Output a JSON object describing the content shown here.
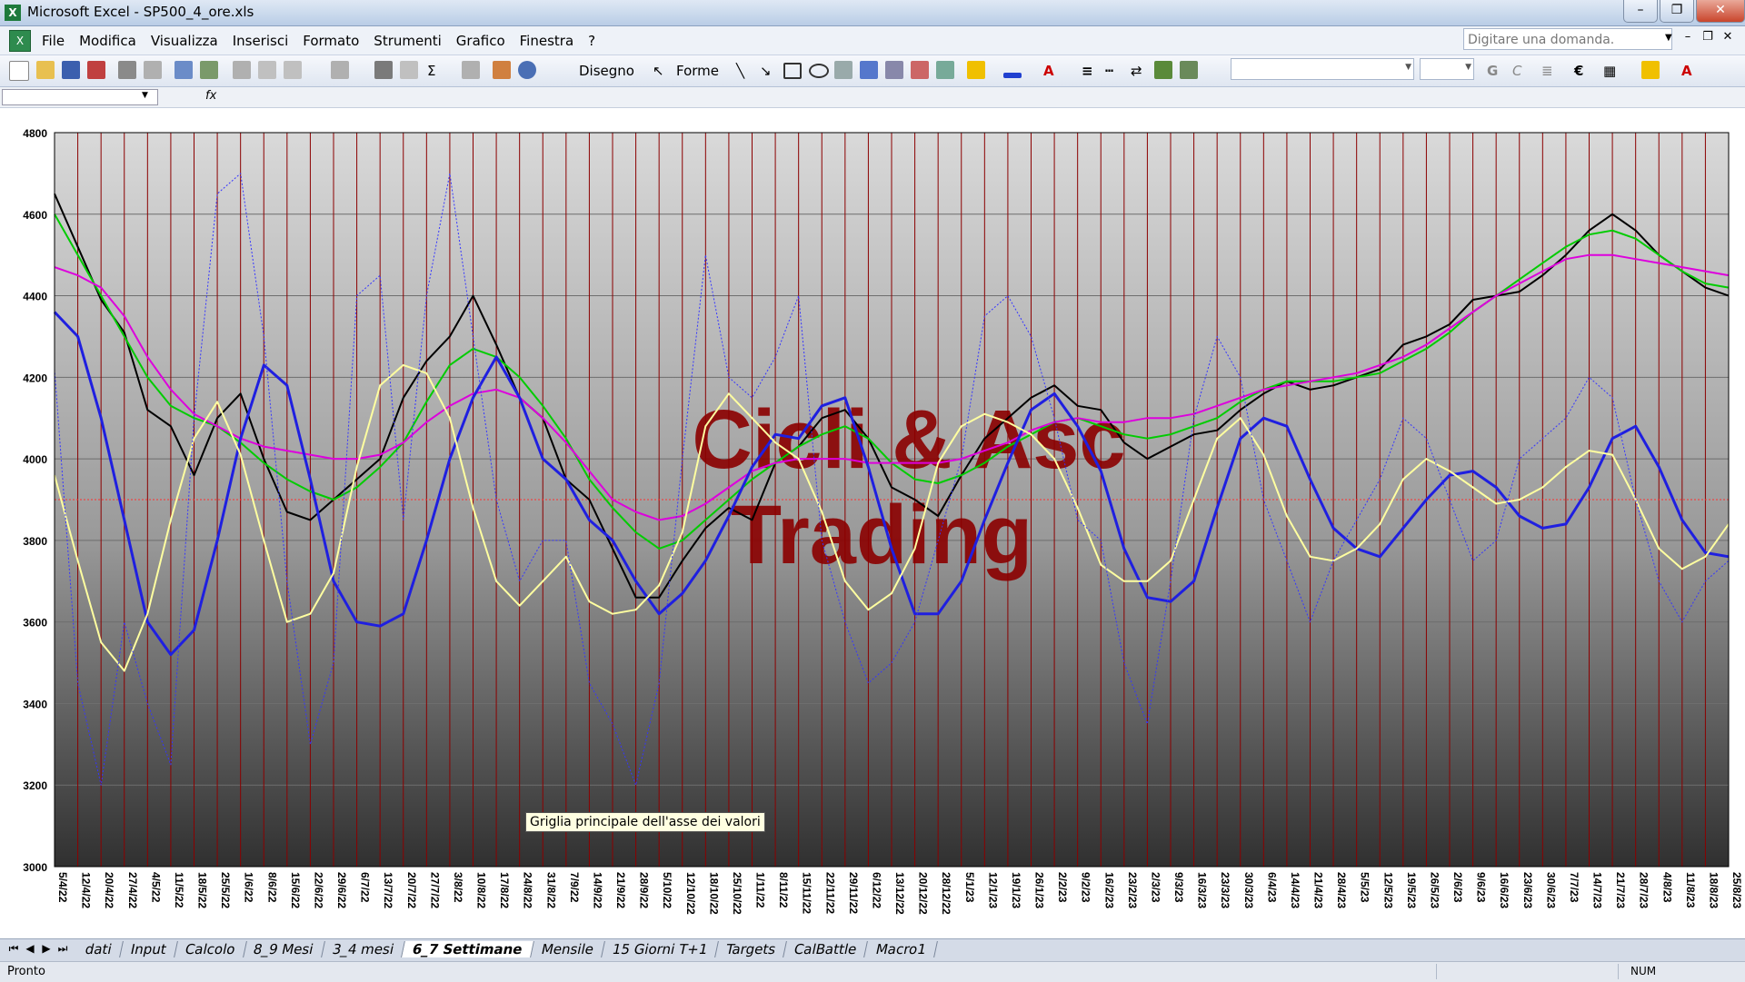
{
  "window": {
    "title": "Microsoft Excel - SP500_4_ore.xls",
    "icon": "excel-icon"
  },
  "menu": {
    "items": [
      "File",
      "Modifica",
      "Visualizza",
      "Inserisci",
      "Formato",
      "Strumenti",
      "Grafico",
      "Finestra",
      "?"
    ],
    "ask_placeholder": "Digitare una domanda."
  },
  "toolbar": {
    "drawing_label": "Disegno",
    "shapes_label": "Forme",
    "bold_label": "G",
    "italic_label": "C",
    "euro_label": "€"
  },
  "formula": {
    "fx": "fx"
  },
  "tooltip": "Griglia principale dell'asse dei valori",
  "sheets": {
    "tabs": [
      "dati",
      "Input",
      "Calcolo",
      "8_9 Mesi",
      "3_4 mesi",
      "6_7 Settimane",
      "Mensile",
      "15 Giorni T+1",
      "Targets",
      "CalBattle",
      "Macro1"
    ],
    "active": "6_7 Settimane"
  },
  "status": {
    "left": "Pronto",
    "num": "NUM"
  },
  "chart_data": {
    "type": "line",
    "watermark": [
      "Cicli & Asc",
      "Trading"
    ],
    "y_ticks": [
      "4800",
      "4600",
      "4400",
      "4200",
      "4000",
      "3800",
      "3600",
      "3400",
      "3200",
      "3000"
    ],
    "ylim": [
      3000,
      4800
    ],
    "reference_line": 3900,
    "x_labels": [
      "5/4/22",
      "12/4/22",
      "20/4/22",
      "27/4/22",
      "4/5/22",
      "11/5/22",
      "18/5/22",
      "25/5/22",
      "1/6/22",
      "8/6/22",
      "15/6/22",
      "22/6/22",
      "29/6/22",
      "6/7/22",
      "13/7/22",
      "20/7/22",
      "27/7/22",
      "3/8/22",
      "10/8/22",
      "17/8/22",
      "24/8/22",
      "31/8/22",
      "7/9/22",
      "14/9/22",
      "21/9/22",
      "28/9/22",
      "5/10/22",
      "12/10/22",
      "18/10/22",
      "25/10/22",
      "1/11/22",
      "8/11/22",
      "15/11/22",
      "22/11/22",
      "29/11/22",
      "6/12/22",
      "13/12/22",
      "20/12/22",
      "28/12/22",
      "5/1/23",
      "12/1/23",
      "19/1/23",
      "26/1/23",
      "2/2/23",
      "9/2/23",
      "16/2/23",
      "23/2/23",
      "2/3/23",
      "9/3/23",
      "16/3/23",
      "23/3/23",
      "30/3/23",
      "6/4/23",
      "14/4/23",
      "21/4/23",
      "28/4/23",
      "5/5/23",
      "12/5/23",
      "19/5/23",
      "26/5/23",
      "2/6/23",
      "9/6/23",
      "16/6/23",
      "23/6/23",
      "30/6/23",
      "7/7/23",
      "14/7/23",
      "21/7/23",
      "28/7/23",
      "4/8/23",
      "11/8/23",
      "18/8/23",
      "25/8/23"
    ],
    "grid": true,
    "series": [
      {
        "color": "#000000",
        "width": 2,
        "values": [
          4650,
          4520,
          4390,
          4310,
          4120,
          4080,
          3960,
          4100,
          4160,
          4000,
          3870,
          3850,
          3900,
          3950,
          4000,
          4150,
          4240,
          4300,
          4400,
          4280,
          4150,
          4100,
          3950,
          3900,
          3780,
          3660,
          3660,
          3750,
          3830,
          3880,
          3850,
          3990,
          4030,
          4100,
          4120,
          4050,
          3930,
          3900,
          3860,
          3960,
          4050,
          4100,
          4150,
          4180,
          4130,
          4120,
          4040,
          4000,
          4030,
          4060,
          4070,
          4120,
          4160,
          4190,
          4170,
          4180,
          4200,
          4220,
          4280,
          4300,
          4330,
          4390,
          4400,
          4410,
          4450,
          4500,
          4560,
          4600,
          4560,
          4500,
          4460,
          4420,
          4400
        ]
      },
      {
        "color": "#00cc00",
        "width": 2,
        "values": [
          4600,
          4500,
          4400,
          4300,
          4200,
          4130,
          4100,
          4080,
          4040,
          3990,
          3950,
          3920,
          3900,
          3930,
          3980,
          4040,
          4140,
          4230,
          4270,
          4250,
          4200,
          4130,
          4050,
          3950,
          3880,
          3820,
          3780,
          3800,
          3850,
          3900,
          3950,
          3990,
          4030,
          4060,
          4080,
          4050,
          3990,
          3950,
          3940,
          3960,
          3990,
          4030,
          4060,
          4090,
          4100,
          4080,
          4060,
          4050,
          4060,
          4080,
          4100,
          4140,
          4170,
          4190,
          4190,
          4190,
          4200,
          4210,
          4240,
          4270,
          4310,
          4360,
          4400,
          4440,
          4480,
          4520,
          4550,
          4560,
          4540,
          4500,
          4460,
          4430,
          4420
        ]
      },
      {
        "color": "#dd00dd",
        "width": 2,
        "values": [
          4470,
          4450,
          4420,
          4350,
          4250,
          4170,
          4110,
          4080,
          4050,
          4030,
          4020,
          4010,
          4000,
          4000,
          4010,
          4040,
          4090,
          4130,
          4160,
          4170,
          4150,
          4100,
          4040,
          3970,
          3900,
          3870,
          3850,
          3860,
          3890,
          3930,
          3970,
          3990,
          4000,
          4000,
          4000,
          3990,
          3990,
          3990,
          3990,
          4000,
          4020,
          4040,
          4070,
          4090,
          4100,
          4090,
          4090,
          4100,
          4100,
          4110,
          4130,
          4150,
          4170,
          4180,
          4190,
          4200,
          4210,
          4230,
          4250,
          4280,
          4320,
          4360,
          4400,
          4430,
          4460,
          4490,
          4500,
          4500,
          4490,
          4480,
          4470,
          4460,
          4450
        ]
      },
      {
        "color": "#1f1fe0",
        "width": 3,
        "values": [
          4360,
          4300,
          4100,
          3850,
          3600,
          3520,
          3580,
          3800,
          4050,
          4230,
          4180,
          3950,
          3700,
          3600,
          3590,
          3620,
          3800,
          4000,
          4150,
          4250,
          4150,
          4000,
          3950,
          3850,
          3800,
          3700,
          3620,
          3670,
          3750,
          3860,
          3980,
          4060,
          4050,
          4130,
          4150,
          3980,
          3780,
          3620,
          3620,
          3700,
          3850,
          3990,
          4120,
          4160,
          4080,
          3970,
          3780,
          3660,
          3650,
          3700,
          3880,
          4050,
          4100,
          4080,
          3950,
          3830,
          3780,
          3760,
          3830,
          3900,
          3960,
          3970,
          3930,
          3860,
          3830,
          3840,
          3930,
          4050,
          4080,
          3980,
          3850,
          3770,
          3760
        ]
      },
      {
        "color": "#ffffa0",
        "width": 2,
        "values": [
          3960,
          3750,
          3550,
          3480,
          3620,
          3850,
          4050,
          4140,
          4010,
          3800,
          3600,
          3620,
          3720,
          3980,
          4180,
          4230,
          4210,
          4100,
          3880,
          3700,
          3640,
          3700,
          3760,
          3650,
          3620,
          3630,
          3690,
          3820,
          4080,
          4160,
          4100,
          4040,
          4000,
          3870,
          3700,
          3630,
          3670,
          3780,
          3990,
          4080,
          4110,
          4090,
          4060,
          4000,
          3880,
          3740,
          3700,
          3700,
          3750,
          3900,
          4050,
          4100,
          4010,
          3860,
          3760,
          3750,
          3780,
          3840,
          3950,
          4000,
          3970,
          3930,
          3890,
          3900,
          3930,
          3980,
          4020,
          4010,
          3900,
          3780,
          3730,
          3760,
          3840
        ]
      },
      {
        "color": "#3535ff",
        "width": 1,
        "dashed": true,
        "values": [
          4220,
          3450,
          3200,
          3600,
          3400,
          3250,
          4100,
          4650,
          4700,
          4300,
          3700,
          3300,
          3500,
          4400,
          4450,
          3850,
          4400,
          4700,
          4300,
          3900,
          3700,
          3800,
          3800,
          3450,
          3350,
          3200,
          3450,
          4000,
          4500,
          4200,
          4150,
          4250,
          4400,
          3800,
          3600,
          3450,
          3500,
          3600,
          3800,
          4000,
          4350,
          4400,
          4300,
          4100,
          3850,
          3800,
          3500,
          3350,
          3700,
          4100,
          4300,
          4200,
          3900,
          3750,
          3600,
          3750,
          3850,
          3950,
          4100,
          4050,
          3900,
          3750,
          3800,
          4000,
          4050,
          4100,
          4200,
          4150,
          3900,
          3700,
          3600,
          3700,
          3750
        ]
      }
    ]
  }
}
